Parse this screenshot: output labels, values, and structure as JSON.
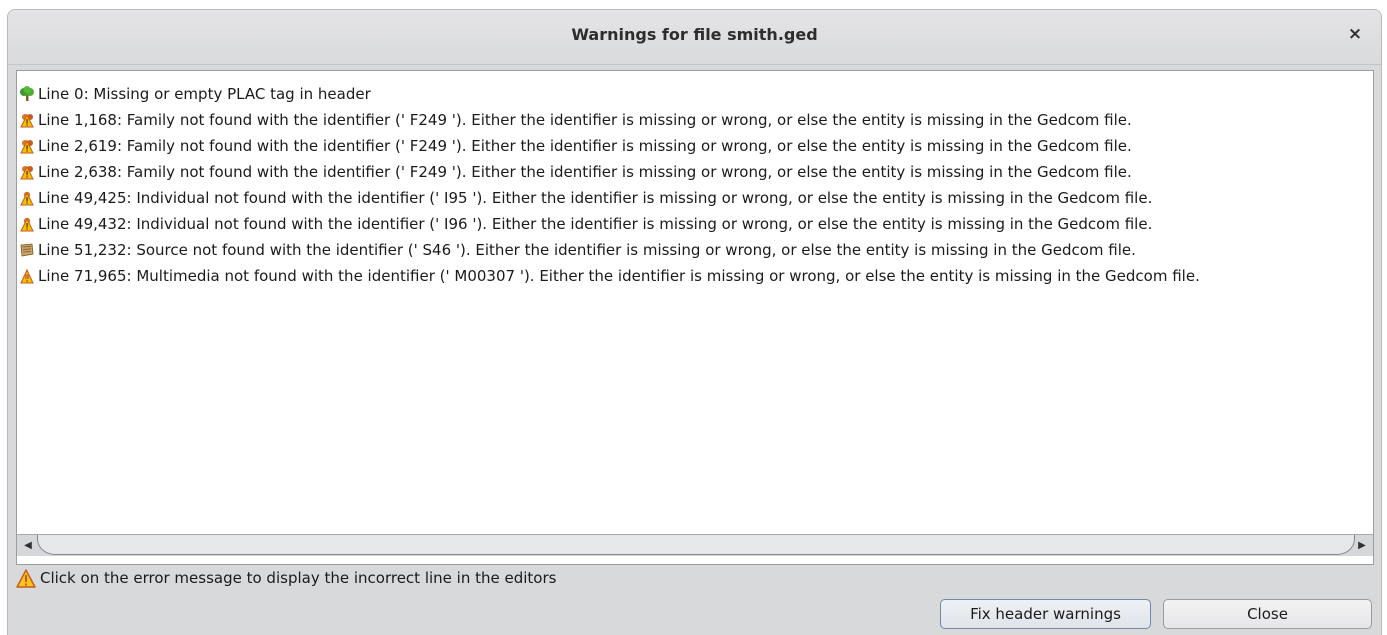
{
  "dialog": {
    "title": "Warnings for file smith.ged",
    "close_glyph": "×"
  },
  "warnings": [
    {
      "icon": "tree-icon",
      "text": "Line 0: Missing or empty PLAC tag in header"
    },
    {
      "icon": "family-warning-icon",
      "text": "Line 1,168: Family not found with the identifier (' F249 '). Either the identifier is missing or wrong, or else the entity is missing in the Gedcom file."
    },
    {
      "icon": "family-warning-icon",
      "text": "Line 2,619: Family not found with the identifier (' F249 '). Either the identifier is missing or wrong, or else the entity is missing in the Gedcom file."
    },
    {
      "icon": "family-warning-icon",
      "text": "Line 2,638: Family not found with the identifier (' F249 '). Either the identifier is missing or wrong, or else the entity is missing in the Gedcom file."
    },
    {
      "icon": "individual-warning-icon",
      "text": "Line 49,425: Individual not found with the identifier (' I95 '). Either the identifier is missing or wrong, or else the entity is missing in the Gedcom file."
    },
    {
      "icon": "individual-warning-icon",
      "text": "Line 49,432: Individual not found with the identifier (' I96 '). Either the identifier is missing or wrong, or else the entity is missing in the Gedcom file."
    },
    {
      "icon": "source-icon",
      "text": "Line 51,232: Source not found with the identifier (' S46 '). Either the identifier is missing or wrong, or else the entity is missing in the Gedcom file."
    },
    {
      "icon": "multimedia-warning-icon",
      "text": "Line 71,965: Multimedia not found with the identifier (' M00307 '). Either the identifier is missing or wrong, or else the entity is missing in the Gedcom file."
    }
  ],
  "hint": {
    "icon": "warning-triangle-icon",
    "text": "Click on the error message to display the incorrect line in the editors"
  },
  "buttons": {
    "fix_label": "Fix header warnings",
    "close_label": "Close"
  },
  "colors": {
    "accent_border": "#6f8aa6",
    "warning_yellow": "#f2c200",
    "warning_orange": "#e06a1b"
  }
}
